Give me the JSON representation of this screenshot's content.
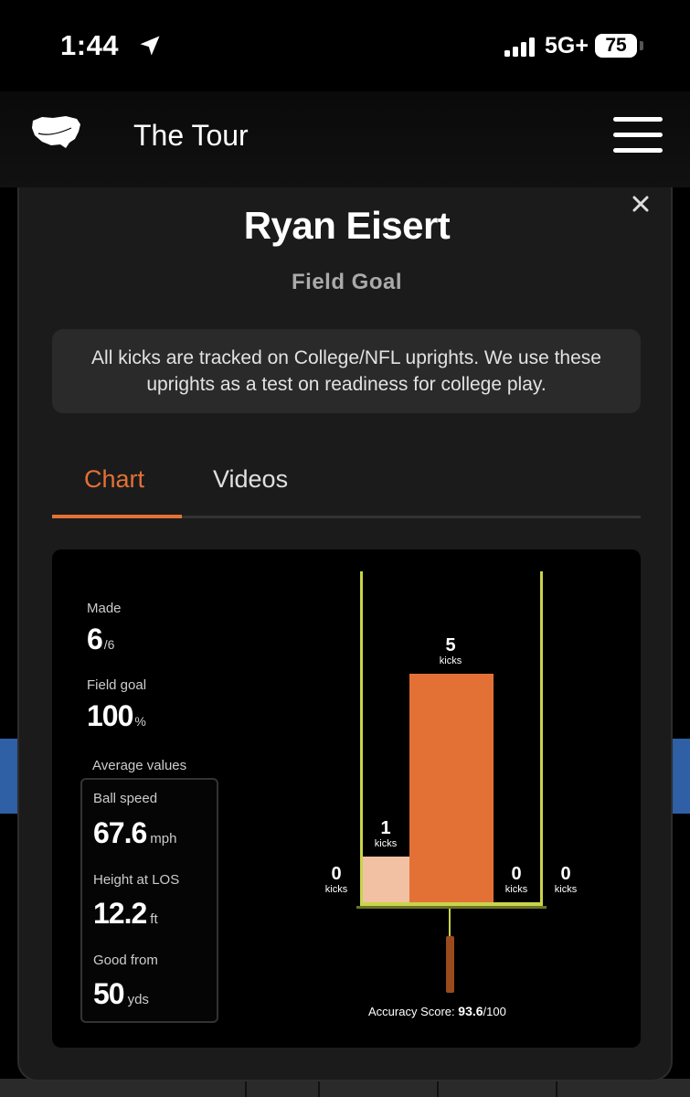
{
  "status_bar": {
    "time": "1:44",
    "network": "5G+",
    "battery": "75"
  },
  "nav": {
    "brand": "The Tour",
    "logo_text": "THE TOUR"
  },
  "modal": {
    "player_name": "Ryan Eisert",
    "kick_type": "Field Goal",
    "notice_line1": "All kicks are tracked on College/NFL uprights. We use these",
    "notice_line2": "uprights as a test on readiness for college play.",
    "tabs": [
      {
        "label": "Chart",
        "active": true
      },
      {
        "label": "Videos",
        "active": false
      }
    ]
  },
  "stats": {
    "made_label": "Made",
    "made_value": "6",
    "made_unit": "/6",
    "fg_label": "Field goal",
    "fg_value": "100",
    "fg_unit": "%",
    "avg_title": "Average values",
    "ball_speed_label": "Ball speed",
    "ball_speed_value": "67.6",
    "ball_speed_unit": "mph",
    "height_label": "Height at LOS",
    "height_value": "12.2",
    "height_unit": "ft",
    "good_from_label": "Good from",
    "good_from_value": "50",
    "good_from_unit": "yds"
  },
  "chart_data": {
    "type": "bar",
    "unit_label": "kicks",
    "bins": [
      {
        "position": "wide-left",
        "kicks": 0,
        "label": "0"
      },
      {
        "position": "left-inside",
        "kicks": 1,
        "label": "1"
      },
      {
        "position": "center",
        "kicks": 5,
        "label": "5"
      },
      {
        "position": "right-inside",
        "kicks": 0,
        "label": "0"
      },
      {
        "position": "wide-right",
        "kicks": 0,
        "label": "0"
      }
    ],
    "colors": {
      "light": "#f2c1a4",
      "main": "#e37136",
      "uprights": "#c8d44a",
      "post": "#9a4a1c"
    },
    "accuracy_label": "Accuracy Score:",
    "accuracy_value": "93.6",
    "accuracy_max": "/100"
  }
}
